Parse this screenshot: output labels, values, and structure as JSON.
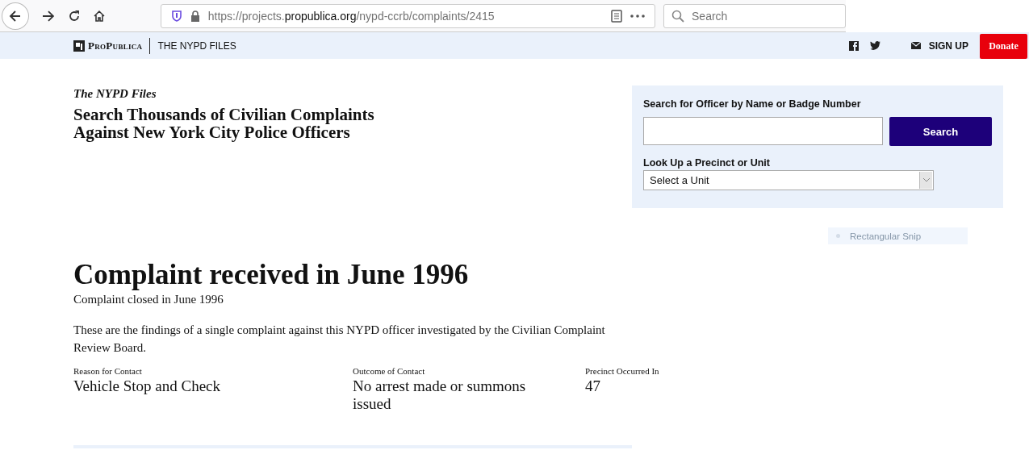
{
  "browser": {
    "url_host_prefix": "https://projects.",
    "url_domain": "propublica.org",
    "url_path": "/nypd-ccrb/complaints/2415",
    "search_placeholder": "Search"
  },
  "site_header": {
    "logo": "ProPublica",
    "section": "THE NYPD FILES",
    "signup": "SIGN UP",
    "donate": "Donate"
  },
  "intro": {
    "kicker": "The NYPD Files",
    "headline_lines": [
      "Search Thousands of Civilian Complaints",
      "Against New York City Police Officers"
    ]
  },
  "search_panel": {
    "officer_label": "Search for Officer by Name or Badge Number",
    "search_button": "Search",
    "unit_label": "Look Up a Precinct or Unit",
    "unit_select": "Select a Unit"
  },
  "snip_tooltip": {
    "label": "Rectangular Snip"
  },
  "complaint": {
    "title": "Complaint received in June 1996",
    "closed": "Complaint closed in June 1996",
    "description": "These are the findings of a single complaint against this NYPD officer investigated by the Civilian Complaint Review Board.",
    "facts": [
      {
        "label": "Reason for Contact",
        "value": "Vehicle Stop and Check"
      },
      {
        "label": "Outcome of Contact",
        "value": "No arrest made or summons issued"
      },
      {
        "label": "Precinct Occurred In",
        "value": "47"
      }
    ]
  }
}
